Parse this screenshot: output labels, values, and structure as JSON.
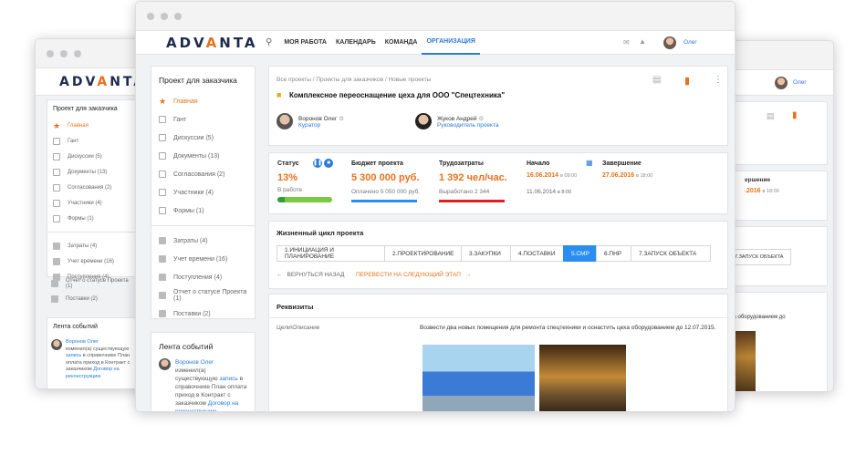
{
  "logo": {
    "text_a1": "A",
    "text_d": "DV",
    "text_a2": "A",
    "text_rest": "NTA"
  },
  "nav": [
    {
      "label": "МОЯ РАБОТА"
    },
    {
      "label": "КАЛЕНДАРЬ"
    },
    {
      "label": "КОМАНДА"
    },
    {
      "label": "ОРГАНИЗАЦИЯ"
    }
  ],
  "user": {
    "name": "Олег"
  },
  "sidebar": {
    "title": "Проект для заказчика",
    "items": [
      {
        "label": "Главная"
      },
      {
        "label": "Гант"
      },
      {
        "label": "Дискуссии (5)"
      },
      {
        "label": "Документы (13)"
      },
      {
        "label": "Согласования (2)"
      },
      {
        "label": "Участники (4)"
      },
      {
        "label": "Формы (1)"
      }
    ],
    "items2": [
      {
        "label": "Затраты (4)"
      },
      {
        "label": "Учет времени (16)"
      },
      {
        "label": "Поступления (4)"
      },
      {
        "label": "Отчет о статусе Проекта (1)"
      },
      {
        "label": "Поставки (2)"
      }
    ]
  },
  "feed": {
    "title": "Лента событий",
    "author": "Воронов Олег",
    "text1": "изменил(а) существующую",
    "link1": "запись",
    "text2": "в справочнике План оплата приход",
    "text3": "в Контракт с заказчиком",
    "link2": "Договор на реконструкцию"
  },
  "project": {
    "breadcrumb": "Все проекты / Проекты для заказчиков / Новые проекты",
    "title": "Комплексное переоснащение цеха для ООО \"Спецтехника\"",
    "person1": {
      "name": "Воронов Олег",
      "role": "Куратор"
    },
    "person2": {
      "name": "Жуков Андрей",
      "role": "Руководитель проекта"
    }
  },
  "stats": {
    "status_label": "Статус",
    "status_pct": "13%",
    "status_text": "В работе",
    "budget_label": "Бюджет проекта",
    "budget_value": "5 300 000 руб.",
    "budget_paid": "Оплачено 5 050 000 руб.",
    "labor_label": "Трудозатраты",
    "labor_value": "1 392 чел/час.",
    "labor_done": "Выработано 2 344",
    "start_label": "Начало",
    "start_value": "16.06.2014",
    "start_time": "в 09:00",
    "start_plan": "11.06.2014",
    "start_plan_time": "в 8:00",
    "end_label": "Завершение",
    "end_value": "27.06.2016",
    "end_time": "в 18:00"
  },
  "lifecycle": {
    "title": "Жизненный цикл проекта",
    "steps": [
      {
        "label": "1.ИНИЦИАЦИЯ И ПЛАНИРОВАНИЕ"
      },
      {
        "label": "2.ПРОЕКТИРОВАНИЕ"
      },
      {
        "label": "3.ЗАКУПКИ"
      },
      {
        "label": "4.ПОСТАВКИ"
      },
      {
        "label": "5.СМР"
      },
      {
        "label": "6.ПНР"
      },
      {
        "label": "7.ЗАПУСК ОБЪЕКТА"
      }
    ],
    "back": "ВЕРНУТЬСЯ НАЗАД",
    "next": "ПЕРЕВЕСТИ НА СЛЕДУЮЩИЙ ЭТАП"
  },
  "requisites": {
    "title": "Реквизиты",
    "field_label": "Цели\\Описание",
    "field_value": "Возвести два новых помещения для ремонта спецтехники и оснастить цеха оборудованием до 12.07.2015."
  },
  "right_win": {
    "end_label": "ершение",
    "end_value": ".2016",
    "end_time": "в 18:00",
    "step": "7.ЗАПУСК ОБЪЕКТА",
    "text": "цеха оборудованием до"
  },
  "colors": {
    "accent": "#2a7ad8",
    "orange": "#e8721c",
    "green": "#7ac943",
    "red": "#e02020"
  }
}
